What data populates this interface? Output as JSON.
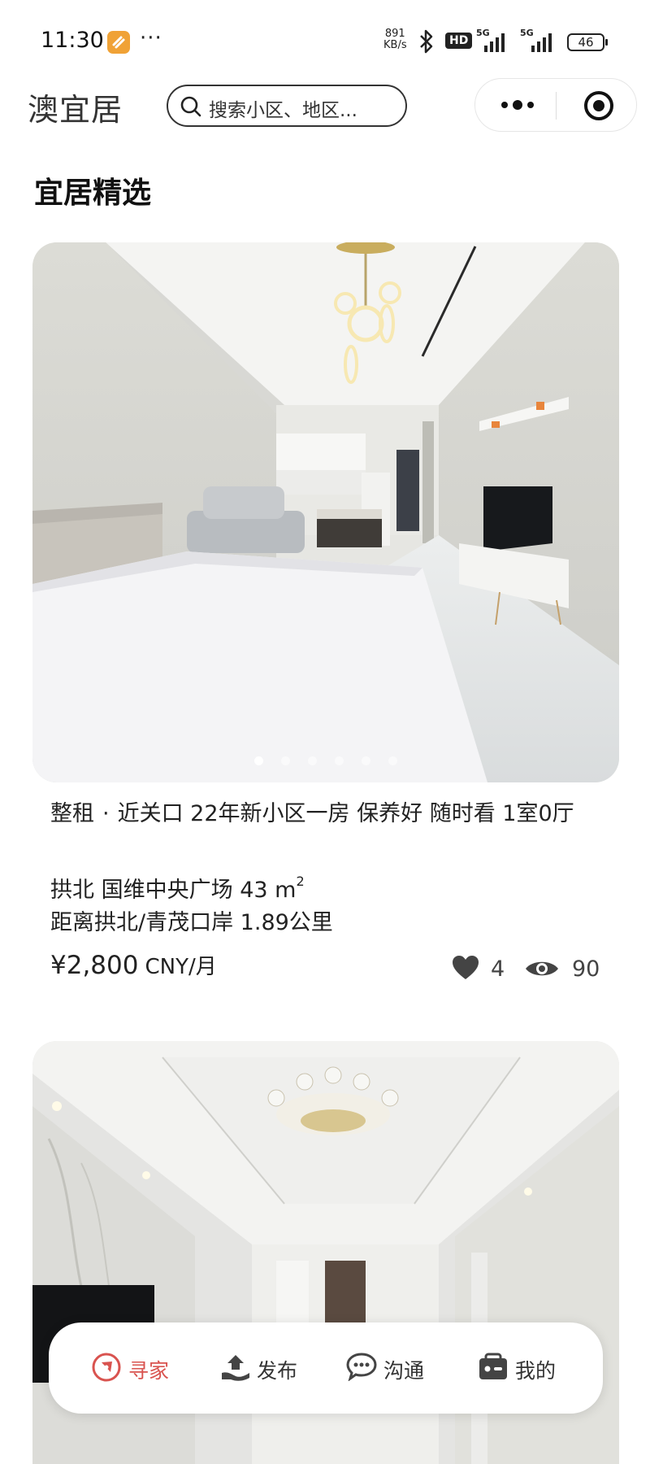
{
  "status_bar": {
    "time": "11:30",
    "dots": "···",
    "speed_value": "891",
    "speed_unit": "KB/s",
    "hd": "HD",
    "net1": "5G",
    "net2": "5G",
    "battery": "46"
  },
  "header": {
    "app_title": "澳宜居",
    "search_placeholder": "搜索小区、地区..."
  },
  "section": {
    "title": "宜居精选"
  },
  "listing": {
    "type": "整租",
    "separator": "·",
    "title": "近关口 22年新小区一房 保养好 随时看 1室0厅",
    "location": "拱北 国维中央广场",
    "area": "43 m",
    "area_sup": "2",
    "distance": "距离拱北/青茂口岸 1.89公里",
    "price": "¥2,800",
    "price_unit": "CNY/月",
    "likes": "4",
    "views": "90",
    "photo_count": 6,
    "active_photo": 1
  },
  "bottom_nav": {
    "items": [
      {
        "label": "寻家",
        "icon": "compass-icon",
        "active": true
      },
      {
        "label": "发布",
        "icon": "publish-icon",
        "active": false
      },
      {
        "label": "沟通",
        "icon": "chat-icon",
        "active": false
      },
      {
        "label": "我的",
        "icon": "profile-icon",
        "active": false
      }
    ]
  },
  "colors": {
    "accent": "#d9534f",
    "app_icon": "#f0a236"
  }
}
